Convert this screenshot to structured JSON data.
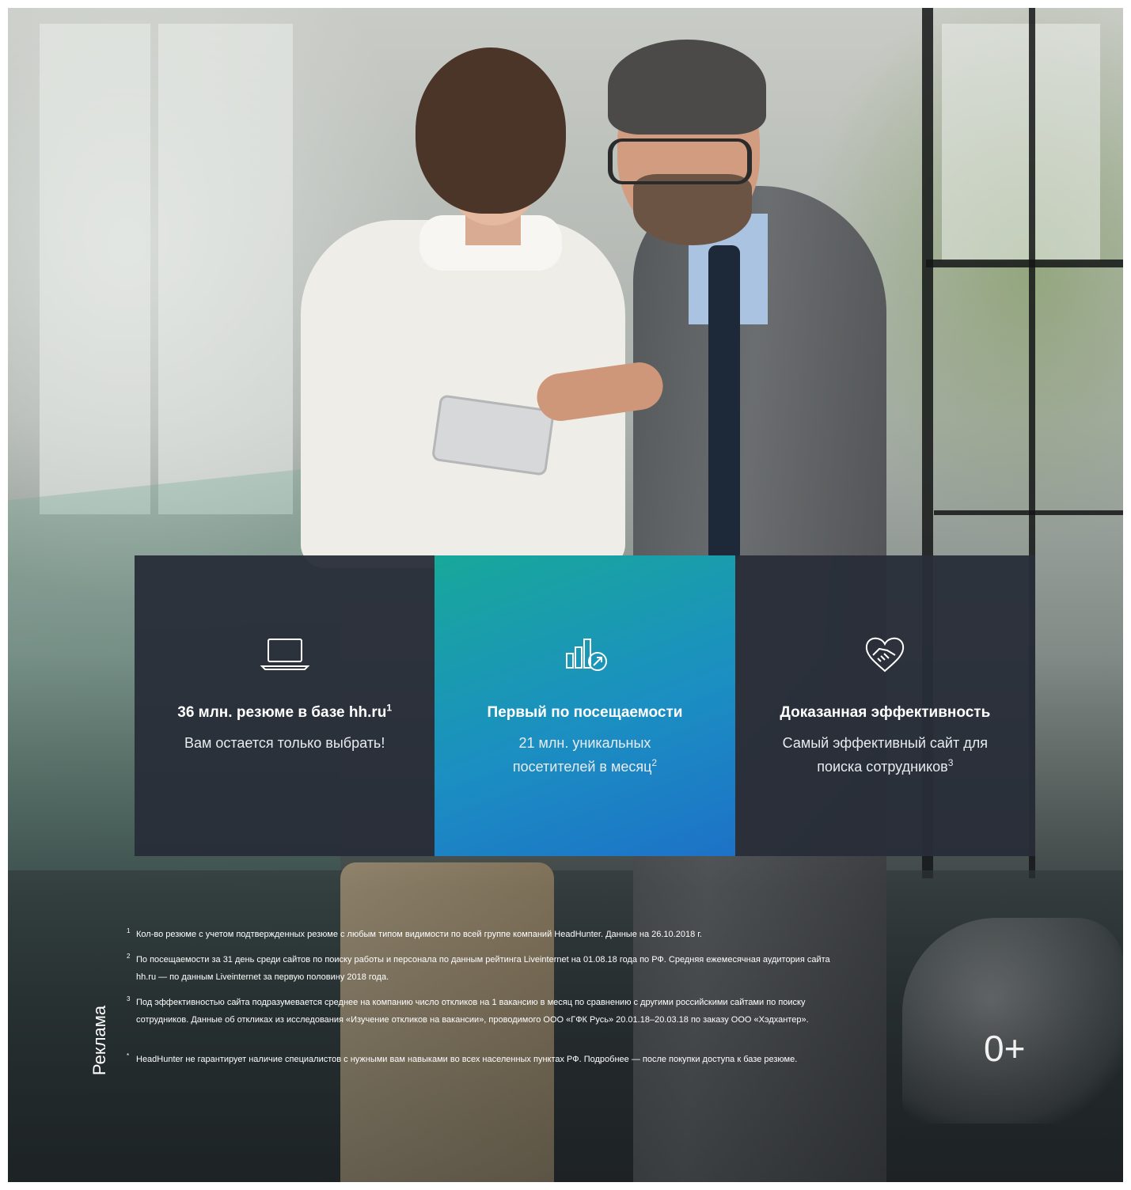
{
  "panels": [
    {
      "icon": "laptop-icon",
      "title": "36 млн. резюме в базе hh.ru",
      "title_sup": "1",
      "text": "Вам остается только выбрать!",
      "text_sup": ""
    },
    {
      "icon": "growth-chart-icon",
      "title": "Первый по посещаемости",
      "title_sup": "",
      "text": "21 млн. уникальных посетителей в месяц",
      "text_sup": "2"
    },
    {
      "icon": "handshake-heart-icon",
      "title": "Доказанная эффективность",
      "title_sup": "",
      "text": "Самый эффективный сайт для поиска сотрудников",
      "text_sup": "3"
    }
  ],
  "footnotes": [
    {
      "mark": "1",
      "text": "Кол-во резюме с учетом подтвержденных резюме с любым типом видимости по всей группе компаний HeadHunter. Данные на 26.10.2018 г."
    },
    {
      "mark": "2",
      "text": "По посещаемости за 31 день среди сайтов по поиску работы и персонала по данным рейтинга Liveinternet на 01.08.18 года по РФ. Средняя ежемесячная аудитория сайта hh.ru — по данным Liveinternet за первую половину 2018 года."
    },
    {
      "mark": "3",
      "text": "Под эффективностью сайта подразумевается среднее на компанию число откликов на 1 вакансию в месяц по сравнению с другими российскими сайтами по поиску сотрудников. Данные об откликах из исследования «Изучение откликов на вакансии», проводимого ООО «ГФК Русь» 20.01.18–20.03.18 по заказу ООО «Хэдхантер»."
    },
    {
      "mark": "*",
      "text": "HeadHunter не гарантирует наличие специалистов с нужными вам навыками во всех населенных пунктах РФ. Подробнее — после покупки доступа к базе резюме."
    }
  ],
  "ad_label": "Реклама",
  "age_rating": "0+",
  "colors": {
    "panel_dark": "#282d38",
    "panel_accent_start": "#18a89a",
    "panel_accent_end": "#1d72c7",
    "text": "#ffffff"
  }
}
